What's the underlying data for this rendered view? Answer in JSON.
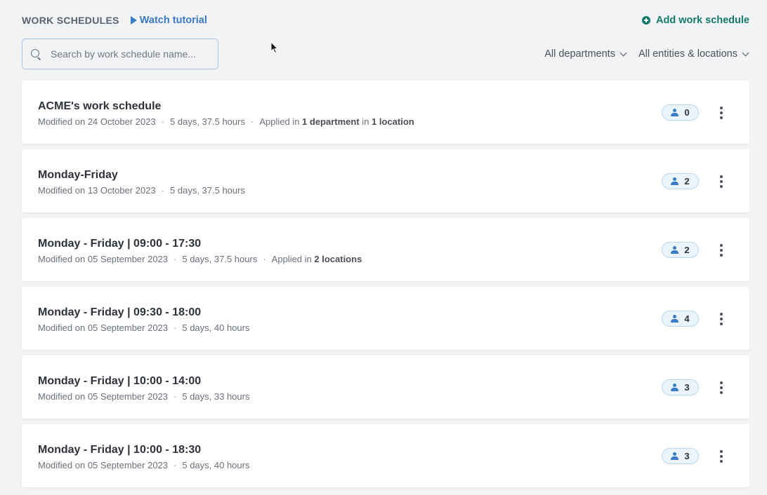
{
  "header": {
    "title": "WORK SCHEDULES",
    "tutorial_label": "Watch tutorial",
    "add_label": "Add work schedule"
  },
  "search": {
    "placeholder": "Search by work schedule name...",
    "value": ""
  },
  "filters": {
    "departments": "All departments",
    "entities": "All entities & locations"
  },
  "colors": {
    "accent_blue": "#3a7bc8",
    "accent_green": "#127a6b",
    "background": "#f2f3f5"
  },
  "schedules": [
    {
      "name": "ACME's work schedule",
      "modified": "Modified on 24 October 2023",
      "summary": "5 days, 37.5 hours",
      "applied": [
        {
          "text": "Applied in ",
          "bold": false
        },
        {
          "text": "1 department",
          "bold": true
        },
        {
          "text": " in ",
          "bold": false
        },
        {
          "text": "1 location",
          "bold": true
        }
      ],
      "employees": "0"
    },
    {
      "name": "Monday-Friday",
      "modified": "Modified on 13 October 2023",
      "summary": "5 days, 37.5 hours",
      "applied": [],
      "employees": "2"
    },
    {
      "name": "Monday - Friday | 09:00 - 17:30",
      "modified": "Modified on 05 September 2023",
      "summary": "5 days, 37.5 hours",
      "applied": [
        {
          "text": "Applied in ",
          "bold": false
        },
        {
          "text": "2 locations",
          "bold": true
        }
      ],
      "employees": "2"
    },
    {
      "name": "Monday - Friday | 09:30 - 18:00",
      "modified": "Modified on 05 September 2023",
      "summary": "5 days, 40 hours",
      "applied": [],
      "employees": "4"
    },
    {
      "name": "Monday - Friday | 10:00 - 14:00",
      "modified": "Modified on 05 September 2023",
      "summary": "5 days, 33 hours",
      "applied": [],
      "employees": "3"
    },
    {
      "name": "Monday - Friday | 10:00 - 18:30",
      "modified": "Modified on 05 September 2023",
      "summary": "5 days, 40 hours",
      "applied": [],
      "employees": "3"
    }
  ],
  "icons": {
    "play": "play-icon",
    "add": "plus-circle-icon",
    "search": "search-icon",
    "chevron": "chevron-down-icon",
    "person": "person-icon",
    "more": "more-vertical-icon",
    "cursor": "mouse-cursor-icon"
  }
}
